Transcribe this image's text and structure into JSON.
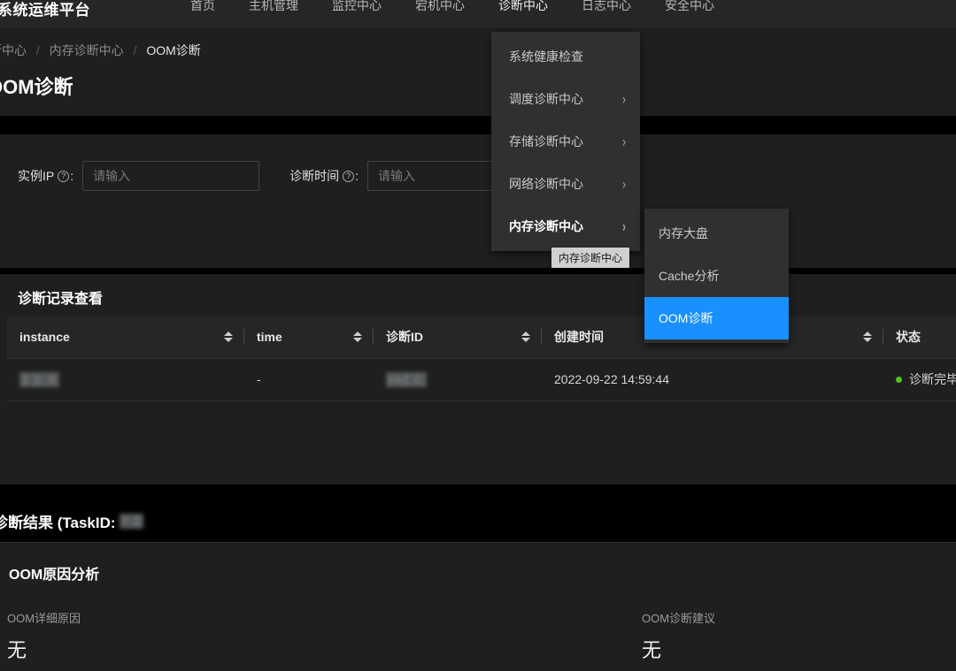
{
  "app": {
    "brand": "系统运维平台"
  },
  "topnav": {
    "items": [
      {
        "label": "首页",
        "active": false
      },
      {
        "label": "主机管理",
        "active": false
      },
      {
        "label": "监控中心",
        "active": false
      },
      {
        "label": "宕机中心",
        "active": false
      },
      {
        "label": "诊断中心",
        "active": true
      },
      {
        "label": "日志中心",
        "active": false
      },
      {
        "label": "安全中心",
        "active": false
      }
    ]
  },
  "breadcrumb": {
    "items": [
      "诊断中心",
      "内存诊断中心",
      "OOM诊断"
    ],
    "separator": "/"
  },
  "page": {
    "title": "OOM诊断"
  },
  "filter": {
    "instance_ip": {
      "label": "实例IP",
      "help_icon": "question-circle-icon",
      "colon": ":",
      "value": "",
      "placeholder": "请输入"
    },
    "diagnose_time": {
      "label": "诊断时间",
      "help_icon": "question-circle-icon",
      "colon": ":",
      "value": "",
      "placeholder": "请输入"
    },
    "search_button": {
      "label": "",
      "icon": "search-icon",
      "color": "#1890ff"
    }
  },
  "records": {
    "title": "诊断记录查看",
    "columns": [
      {
        "key": "instance",
        "label": "instance",
        "sortable": true
      },
      {
        "key": "time",
        "label": "time",
        "sortable": true
      },
      {
        "key": "diag_id",
        "label": "诊断ID",
        "sortable": true
      },
      {
        "key": "create_time",
        "label": "创建时间",
        "sortable": true
      },
      {
        "key": "status",
        "label": "状态",
        "sortable": false
      }
    ],
    "rows": [
      {
        "instance": "1 2. 5",
        "instance_redacted": true,
        "time": "-",
        "diag_id": "cnZ C",
        "diag_id_redacted": true,
        "create_time": "2022-09-22 14:59:44",
        "status": "诊断完毕",
        "status_color": "#52c41a"
      }
    ]
  },
  "result": {
    "title_prefix": "诊断结果 (TaskID:",
    "task_id": "7 Z",
    "task_id_redacted": true
  },
  "analysis": {
    "title": "OOM原因分析",
    "details": [
      {
        "label": "OOM详细原因",
        "value": "无"
      },
      {
        "label": "OOM诊断建议",
        "value": "无"
      }
    ]
  },
  "menu": {
    "level1": [
      {
        "label": "系统健康检查",
        "has_submenu": false,
        "highlighted": false
      },
      {
        "label": "调度诊断中心",
        "has_submenu": true,
        "highlighted": false
      },
      {
        "label": "存储诊断中心",
        "has_submenu": true,
        "highlighted": false
      },
      {
        "label": "网络诊断中心",
        "has_submenu": true,
        "highlighted": false
      },
      {
        "label": "内存诊断中心",
        "has_submenu": true,
        "highlighted": true
      }
    ],
    "chevron": "›",
    "level2": [
      {
        "label": "内存大盘",
        "selected": false
      },
      {
        "label": "Cache分析",
        "selected": false
      },
      {
        "label": "OOM诊断",
        "selected": true
      }
    ],
    "tooltip": "内存诊断中心"
  }
}
